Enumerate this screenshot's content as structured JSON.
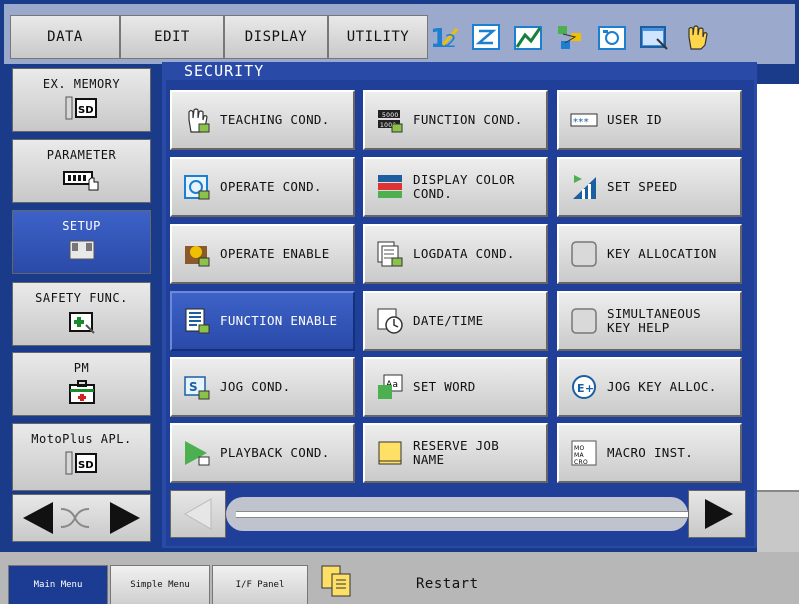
{
  "top_menu": {
    "items": [
      "DATA",
      "EDIT",
      "DISPLAY",
      "UTILITY"
    ],
    "icons": [
      "switch-icon",
      "edit-icon",
      "graph-icon",
      "network-icon",
      "camera-icon",
      "window-icon",
      "hand-icon"
    ]
  },
  "left_menu": {
    "items": [
      {
        "label": "EX. MEMORY",
        "icon": "sd-card-icon"
      },
      {
        "label": "PARAMETER",
        "icon": "parameter-icon"
      },
      {
        "label": "SETUP",
        "icon": "setup-icon"
      },
      {
        "label": "SAFETY FUNC.",
        "icon": "safety-icon"
      },
      {
        "label": "PM",
        "icon": "medical-kit-icon"
      },
      {
        "label": "MotoPlus APL.",
        "icon": "sd-card-icon"
      }
    ]
  },
  "panel": {
    "title": "SECURITY",
    "tiles": [
      {
        "label": "TEACHING COND.",
        "icon": "hand-icon"
      },
      {
        "label": "FUNCTION COND.",
        "icon": "function-icon"
      },
      {
        "label": "USER ID",
        "icon": "password-icon"
      },
      {
        "label": "OPERATE COND.",
        "icon": "operate-icon"
      },
      {
        "label": "DISPLAY COLOR\n COND.",
        "icon": "color-icon"
      },
      {
        "label": "SET SPEED",
        "icon": "speed-icon"
      },
      {
        "label": "OPERATE ENABLE",
        "icon": "enable-icon"
      },
      {
        "label": "LOGDATA COND.",
        "icon": "log-icon"
      },
      {
        "label": "KEY ALLOCATION",
        "icon": "key-icon"
      },
      {
        "label": "FUNCTION ENABLE",
        "icon": "function-enable-icon"
      },
      {
        "label": "DATE/TIME",
        "icon": "clock-icon"
      },
      {
        "label": "SIMULTANEOUS\n KEY HELP",
        "icon": "key-icon"
      },
      {
        "label": "JOG COND.",
        "icon": "jog-icon"
      },
      {
        "label": "SET WORD",
        "icon": "word-icon"
      },
      {
        "label": "JOG KEY ALLOC.",
        "icon": "jog-key-icon"
      },
      {
        "label": "PLAYBACK COND.",
        "icon": "play-icon"
      },
      {
        "label": "RESERVE JOB\n NAME",
        "icon": "note-icon"
      },
      {
        "label": "MACRO INST.",
        "icon": "macro-icon"
      }
    ]
  },
  "bottom": {
    "tabs": [
      "Main Menu",
      "Simple Menu",
      "I/F Panel"
    ],
    "restart_label": "Restart"
  },
  "colors": {
    "frame": "#1a3a8a",
    "selected": "#2a4aa8",
    "button_face": "#d8d8d8"
  }
}
